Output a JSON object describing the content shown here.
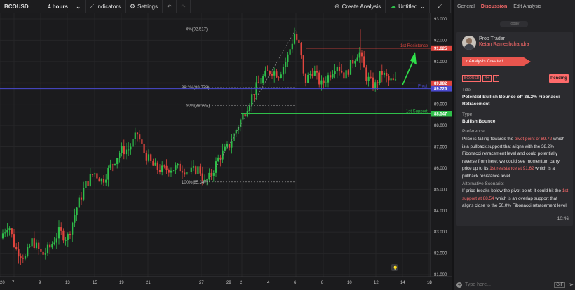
{
  "toolbar": {
    "symbol": "BCOUSD",
    "timeframe": "4 hours",
    "indicators_label": "Indicators",
    "settings_label": "Settings",
    "create_analysis_label": "Create Analysis",
    "layout_label": "Untitled"
  },
  "panel": {
    "tabs": [
      "General",
      "Discussion",
      "Edit Analysis"
    ],
    "active_tab": "Discussion",
    "day_label": "Today",
    "author_role": "Prop Trader",
    "author_name": "Ketan Rameshchandra",
    "status": "Analysis Created",
    "tags": [
      "BCOUSD",
      "4H"
    ],
    "pending_label": "Pending",
    "title_label": "Title",
    "title_value": "Potential Bullish Bounce off 38.2% Fibonacci Retracement",
    "type_label": "Type",
    "type_value": "Bullish Bounce",
    "preference_label": "Preference:",
    "preference_parts": [
      "Price is falling towards the ",
      "pivot point of 89.72",
      " which is a pullback support that aligns with the 38.2% Fibonacci retracement level and could potentially reverse from here; we could see momentum carry price up to its ",
      "1st resistance at 91.62",
      " which is a pullback resistance level."
    ],
    "alternative_label": "Alternative Scenario:",
    "alternative_parts": [
      "If price breaks below the pivot point, it could hit the ",
      "1st support at 88.54",
      " which is an overlap support that aligns close to the 50.0% Fibonacci retracement level."
    ],
    "time": "10:46",
    "input_placeholder": "Type here...",
    "gif_label": "GIF"
  },
  "chart_data": {
    "type": "candlestick",
    "ylim": [
      81,
      93
    ],
    "y_ticks": [
      "93.000",
      "92.000",
      "91.000",
      "90.000",
      "89.000",
      "88.000",
      "87.000",
      "86.000",
      "85.000",
      "84.000",
      "83.000",
      "82.000",
      "81.000"
    ],
    "x_ticks": [
      "7",
      "9",
      "13",
      "15",
      "19",
      "21",
      "27",
      "29",
      "2",
      "4",
      "6",
      "8",
      "10",
      "12",
      "14",
      "16",
      "18",
      "20"
    ],
    "levels": [
      {
        "name": "1st Resistance",
        "value": 91.625,
        "label": "91.625",
        "color": "#e0453e"
      },
      {
        "name": "Pivot",
        "value": 89.726,
        "label": "89.726",
        "color": "#4a4ad0"
      },
      {
        "name": "1st Support",
        "value": 88.547,
        "label": "88.547",
        "color": "#2fbf4a"
      }
    ],
    "current_price": {
      "value": 89.982,
      "label": "89.982",
      "color": "#e0453e"
    },
    "fib_levels": [
      {
        "label": "0%(92.517)",
        "value": 92.517
      },
      {
        "label": "38.2%(89.778)",
        "value": 89.778
      },
      {
        "label": "50%(88.932)",
        "value": 88.932
      },
      {
        "label": "100%(85.347)",
        "value": 85.347
      }
    ],
    "colors": {
      "up": "#2fbf4a",
      "down": "#e0453e",
      "grid": "#262628",
      "axis_text": "#c8c8c8"
    }
  }
}
